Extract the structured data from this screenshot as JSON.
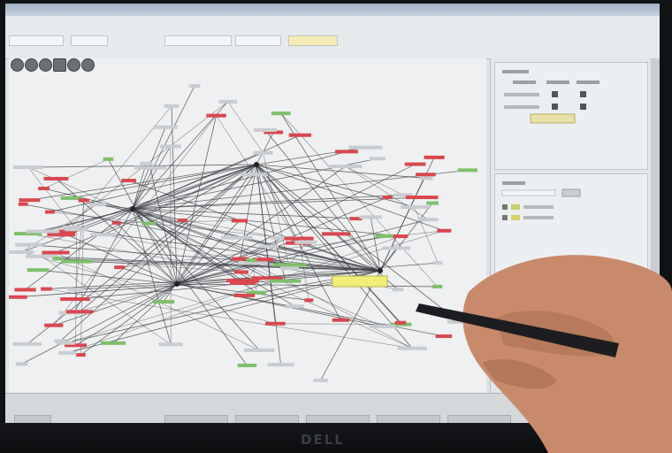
{
  "monitor": {
    "brand": "DELL"
  },
  "colors": {
    "node_red": "#d9474f",
    "node_green": "#7fbf6a",
    "node_yellow": "#f2ee7a",
    "edge": "#3a3c40",
    "screen_bg": "#eef0f1",
    "skin": "#c98a6c",
    "pen": "#1c1d20"
  },
  "icons": [
    "zoom-in-icon",
    "zoom-out-icon",
    "fit-icon",
    "layout-icon",
    "back-icon",
    "forward-icon"
  ]
}
